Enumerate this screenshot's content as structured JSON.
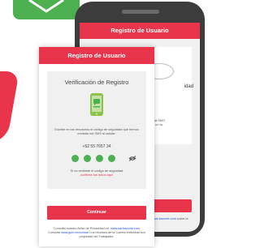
{
  "background_phone": {
    "header_title": "Registro de Usuario",
    "partial_label": "idad",
    "partial_text": "ado vía SMS\nnocer un la",
    "partial_footer_prefix": "ad en ",
    "partial_footer_link": "www.sar.banorte.com",
    "partial_footer_rest": "sobre la Cuenta\nrajador."
  },
  "card": {
    "header_title": "Registro de Usuario",
    "verification_title": "Verificación de Registro",
    "instruction": "Escribe en los recuadros el código de seguridad que hemos enviado vía SMS al celular:",
    "phone_number": "+52 55 7657 34",
    "code_dots_filled": 4,
    "resend_prefix": "Si no recibiste el código de seguridad",
    "resend_link": "confirma tus datos aquí",
    "continue_label": "Continuar",
    "footer_prefix": "Consulta nuestro Aviso de Privacidad en:",
    "footer_link1": "www.sar.banorte.com",
    "footer_mid": "Consulta",
    "footer_link2": "www.gob.mx/consar",
    "footer_rest": "Los recursos de la Cuenta Individual son propiedad del Trabajador."
  },
  "colors": {
    "brand_red": "#e8354b",
    "success_green": "#4caf50",
    "link_blue": "#1a4fd0"
  },
  "icons": {
    "banner": "chevron-down-icon",
    "sms": "sms-message-icon",
    "visibility": "eye-icon"
  }
}
